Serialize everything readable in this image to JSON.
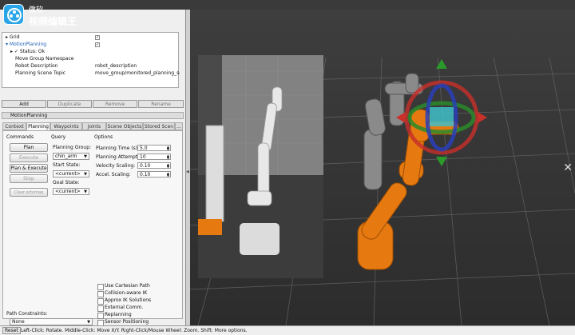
{
  "watermark": {
    "line1": "傲软",
    "line2": "视频编辑王"
  },
  "displays_tree": {
    "rows": [
      {
        "label": "Grid",
        "checked": true
      },
      {
        "label": "MotionPlanning",
        "checked": true
      },
      {
        "label": "Status: Ok",
        "value": ""
      },
      {
        "label": "Move Group Namespace",
        "value": ""
      },
      {
        "label": "Robot Description",
        "value": "robot_description"
      },
      {
        "label": "Planning Scene Topic",
        "value": "move_group/monitored_planning_sce..."
      }
    ]
  },
  "display_buttons": {
    "add": "Add",
    "duplicate": "Duplicate",
    "remove": "Remove",
    "rename": "Rename"
  },
  "motion_planning": {
    "title": "MotionPlanning",
    "tabs": [
      "Context",
      "Planning",
      "Waypoints",
      "Joints",
      "Scene Objects",
      "Stored Scen",
      "..."
    ],
    "selected_tab": "Planning",
    "commands": {
      "header": "Commands",
      "plan": "Plan",
      "execute": "Execute",
      "plan_execute": "Plan & Execute",
      "stop": "Stop",
      "clear_octomap": "Clear octomap"
    },
    "query": {
      "header": "Query",
      "planning_group_label": "Planning Group:",
      "planning_group_value": "chin_arm",
      "start_state_label": "Start State:",
      "start_state_value": "<current>",
      "goal_state_label": "Goal State:",
      "goal_state_value": "<current>"
    },
    "options": {
      "header": "Options",
      "fields": [
        {
          "label": "Planning Time (s):",
          "value": "5.0"
        },
        {
          "label": "Planning Attempts:",
          "value": "10"
        },
        {
          "label": "Velocity Scaling:",
          "value": "0.10"
        },
        {
          "label": "Accel. Scaling:",
          "value": "0.10"
        }
      ],
      "checkboxes": [
        "Use Cartesian Path",
        "Collision-aware IK",
        "Approx IK Solutions",
        "External Comm.",
        "Replanning",
        "Sensor Positioning"
      ]
    },
    "path_constraints": {
      "label": "Path Constraints:",
      "value": "None"
    }
  },
  "status_bar": {
    "reset": "Reset",
    "text": "Left-Click: Rotate.  Middle-Click: Move X/Y.  Right-Click/Mouse Wheel: Zoom.  Shift: More options."
  },
  "colors": {
    "robot_orange": "#e67a10",
    "robot_gray": "#8a8a8a",
    "grid": "#6a6a6a"
  }
}
